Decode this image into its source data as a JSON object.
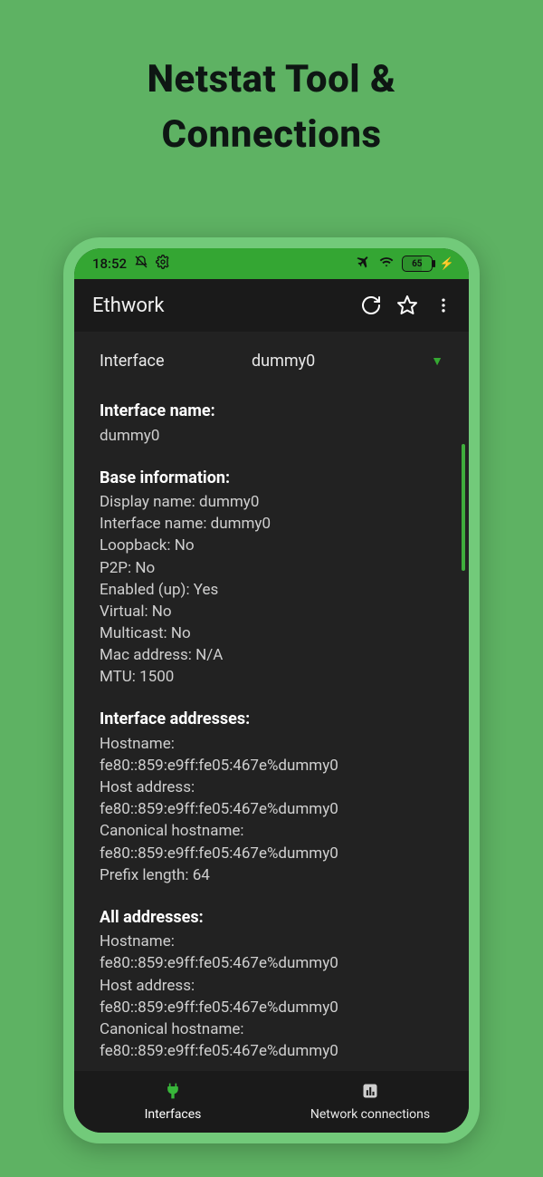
{
  "hero": {
    "line1": "Netstat Tool &",
    "line2": "Connections"
  },
  "status": {
    "time": "18:52",
    "battery_pct": "65"
  },
  "appbar": {
    "title": "Ethwork"
  },
  "interface": {
    "label": "Interface",
    "selected": "dummy0"
  },
  "sections": {
    "name": {
      "head": "Interface name:",
      "value": "dummy0"
    },
    "base": {
      "head": "Base information:",
      "lines": {
        "display_name": "Display name: dummy0",
        "iface_name": "Interface name: dummy0",
        "loopback": "Loopback: No",
        "p2p": "P2P: No",
        "enabled": "Enabled (up): Yes",
        "virtual": "Virtual: No",
        "multicast": "Multicast: No",
        "mac": "Mac address: N/A",
        "mtu": "MTU: 1500"
      }
    },
    "iface_addrs": {
      "head": "Interface addresses:",
      "lines": {
        "hostname_lbl": "Hostname:",
        "hostname_val": "fe80::859:e9ff:fe05:467e%dummy0",
        "hostaddr_lbl": "Host address:",
        "hostaddr_val": "fe80::859:e9ff:fe05:467e%dummy0",
        "canon_lbl": "Canonical hostname:",
        "canon_val": "fe80::859:e9ff:fe05:467e%dummy0",
        "prefix": "Prefix length: 64"
      }
    },
    "all_addrs": {
      "head": "All addresses:",
      "lines": {
        "hostname_lbl": "Hostname:",
        "hostname_val": "fe80::859:e9ff:fe05:467e%dummy0",
        "hostaddr_lbl": "Host address:",
        "hostaddr_val": "fe80::859:e9ff:fe05:467e%dummy0",
        "canon_lbl": "Canonical hostname:",
        "canon_val": "fe80::859:e9ff:fe05:467e%dummy0"
      }
    }
  },
  "nav": {
    "interfaces": "Interfaces",
    "network": "Network connections"
  }
}
